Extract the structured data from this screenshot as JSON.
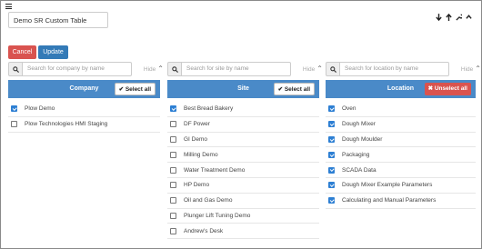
{
  "toolbar": {
    "title": "Demo SR Custom Table",
    "cancel_label": "Cancel",
    "update_label": "Update"
  },
  "columns": [
    {
      "search_placeholder": "Search for company by name",
      "hide_label": "Hide",
      "header": "Company",
      "select_label": "✔ Select all",
      "items": [
        {
          "label": "Plow Demo",
          "checked": true
        },
        {
          "label": "Plow Technologies HMI Staging",
          "checked": false
        }
      ]
    },
    {
      "search_placeholder": "Search for site by name",
      "hide_label": "Hide",
      "header": "Site",
      "select_label": "✔ Select all",
      "items": [
        {
          "label": "Best Bread Bakery",
          "checked": true
        },
        {
          "label": "DF Power",
          "checked": false
        },
        {
          "label": "GI Demo",
          "checked": false
        },
        {
          "label": "Milling Demo",
          "checked": false
        },
        {
          "label": "Water Treatment Demo",
          "checked": false
        },
        {
          "label": "HP Demo",
          "checked": false
        },
        {
          "label": "Oil and Gas Demo",
          "checked": false
        },
        {
          "label": "Plunger Lift Tuning Demo",
          "checked": false
        },
        {
          "label": "Andrew's Desk",
          "checked": false
        }
      ]
    },
    {
      "search_placeholder": "Search for location by name",
      "hide_label": "Hide",
      "header": "Location",
      "select_label": "✖ Unselect all",
      "items": [
        {
          "label": "Oven",
          "checked": true
        },
        {
          "label": "Dough Mixer",
          "checked": true
        },
        {
          "label": "Dough Moulder",
          "checked": true
        },
        {
          "label": "Packaging",
          "checked": true
        },
        {
          "label": "SCADA Data",
          "checked": true
        },
        {
          "label": "Dough Mixer Example Parameters",
          "checked": true
        },
        {
          "label": "Calculating and Manual Parameters",
          "checked": true
        }
      ]
    }
  ],
  "colors": {
    "header_blue": "#4a8ac8",
    "cancel_red": "#d9534f",
    "update_blue": "#337ab7",
    "checkbox_blue": "#2d7fd3"
  },
  "icons": [
    "menu-icon",
    "arrow-down-icon",
    "arrow-up-icon",
    "wrench-icon",
    "chevron-up-icon",
    "search-icon"
  ]
}
